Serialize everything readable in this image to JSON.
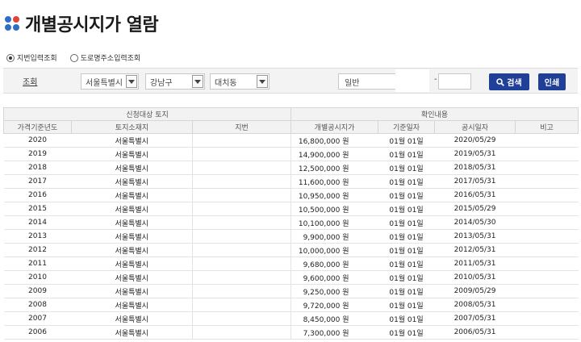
{
  "page": {
    "title": "개별공시지가 열람",
    "logo_colors": [
      "#2d6fc2",
      "#e0453a",
      "#2d6fc2",
      "#2d6fc2"
    ]
  },
  "search_mode": {
    "options": [
      {
        "label": "지번입력조회",
        "selected": true
      },
      {
        "label": "도로명주소입력조회",
        "selected": false
      }
    ]
  },
  "search": {
    "label": "조회",
    "sido": "서울특별시",
    "sigungu": "강남구",
    "dong": "대치동",
    "land_type": "일반",
    "bonbun": "",
    "bubun": "",
    "dash": "-",
    "search_button": "검색",
    "print_button": "인쇄",
    "accent_color": "#1f3f99"
  },
  "table": {
    "group_headers": {
      "request": "신청대상 토지",
      "confirm": "확인내용"
    },
    "columns": {
      "year": "가격기준년도",
      "location": "토지소재지",
      "jibun": "지번",
      "price": "개별공시지가",
      "base_date": "기준일자",
      "notice_date": "공시일자",
      "note": "비고"
    },
    "rows": [
      {
        "year": "2020",
        "location": "서울특별시",
        "jibun": "",
        "price": "16,800,000 원",
        "base_date": "01월 01일",
        "notice_date": "2020/05/29",
        "note": ""
      },
      {
        "year": "2019",
        "location": "서울특별시",
        "jibun": "",
        "price": "14,900,000 원",
        "base_date": "01월 01일",
        "notice_date": "2019/05/31",
        "note": ""
      },
      {
        "year": "2018",
        "location": "서울특별시",
        "jibun": "",
        "price": "12,500,000 원",
        "base_date": "01월 01일",
        "notice_date": "2018/05/31",
        "note": ""
      },
      {
        "year": "2017",
        "location": "서울특별시",
        "jibun": "",
        "price": "11,600,000 원",
        "base_date": "01월 01일",
        "notice_date": "2017/05/31",
        "note": ""
      },
      {
        "year": "2016",
        "location": "서울특별시",
        "jibun": "",
        "price": "10,950,000 원",
        "base_date": "01월 01일",
        "notice_date": "2016/05/31",
        "note": ""
      },
      {
        "year": "2015",
        "location": "서울특별시",
        "jibun": "",
        "price": "10,500,000 원",
        "base_date": "01월 01일",
        "notice_date": "2015/05/29",
        "note": ""
      },
      {
        "year": "2014",
        "location": "서울특별시",
        "jibun": "",
        "price": "10,100,000 원",
        "base_date": "01월 01일",
        "notice_date": "2014/05/30",
        "note": ""
      },
      {
        "year": "2013",
        "location": "서울특별시",
        "jibun": "",
        "price": "9,900,000 원",
        "base_date": "01월 01일",
        "notice_date": "2013/05/31",
        "note": ""
      },
      {
        "year": "2012",
        "location": "서울특별시",
        "jibun": "",
        "price": "10,000,000 원",
        "base_date": "01월 01일",
        "notice_date": "2012/05/31",
        "note": ""
      },
      {
        "year": "2011",
        "location": "서울특별시",
        "jibun": "",
        "price": "9,680,000 원",
        "base_date": "01월 01일",
        "notice_date": "2011/05/31",
        "note": ""
      },
      {
        "year": "2010",
        "location": "서울특별시",
        "jibun": "",
        "price": "9,600,000 원",
        "base_date": "01월 01일",
        "notice_date": "2010/05/31",
        "note": ""
      },
      {
        "year": "2009",
        "location": "서울특별시",
        "jibun": "",
        "price": "9,250,000 원",
        "base_date": "01월 01일",
        "notice_date": "2009/05/29",
        "note": ""
      },
      {
        "year": "2008",
        "location": "서울특별시",
        "jibun": "",
        "price": "9,720,000 원",
        "base_date": "01월 01일",
        "notice_date": "2008/05/31",
        "note": ""
      },
      {
        "year": "2007",
        "location": "서울특별시",
        "jibun": "",
        "price": "8,450,000 원",
        "base_date": "01월 01일",
        "notice_date": "2007/05/31",
        "note": ""
      },
      {
        "year": "2006",
        "location": "서울특별시",
        "jibun": "",
        "price": "7,300,000 원",
        "base_date": "01월 01일",
        "notice_date": "2006/05/31",
        "note": ""
      }
    ]
  }
}
